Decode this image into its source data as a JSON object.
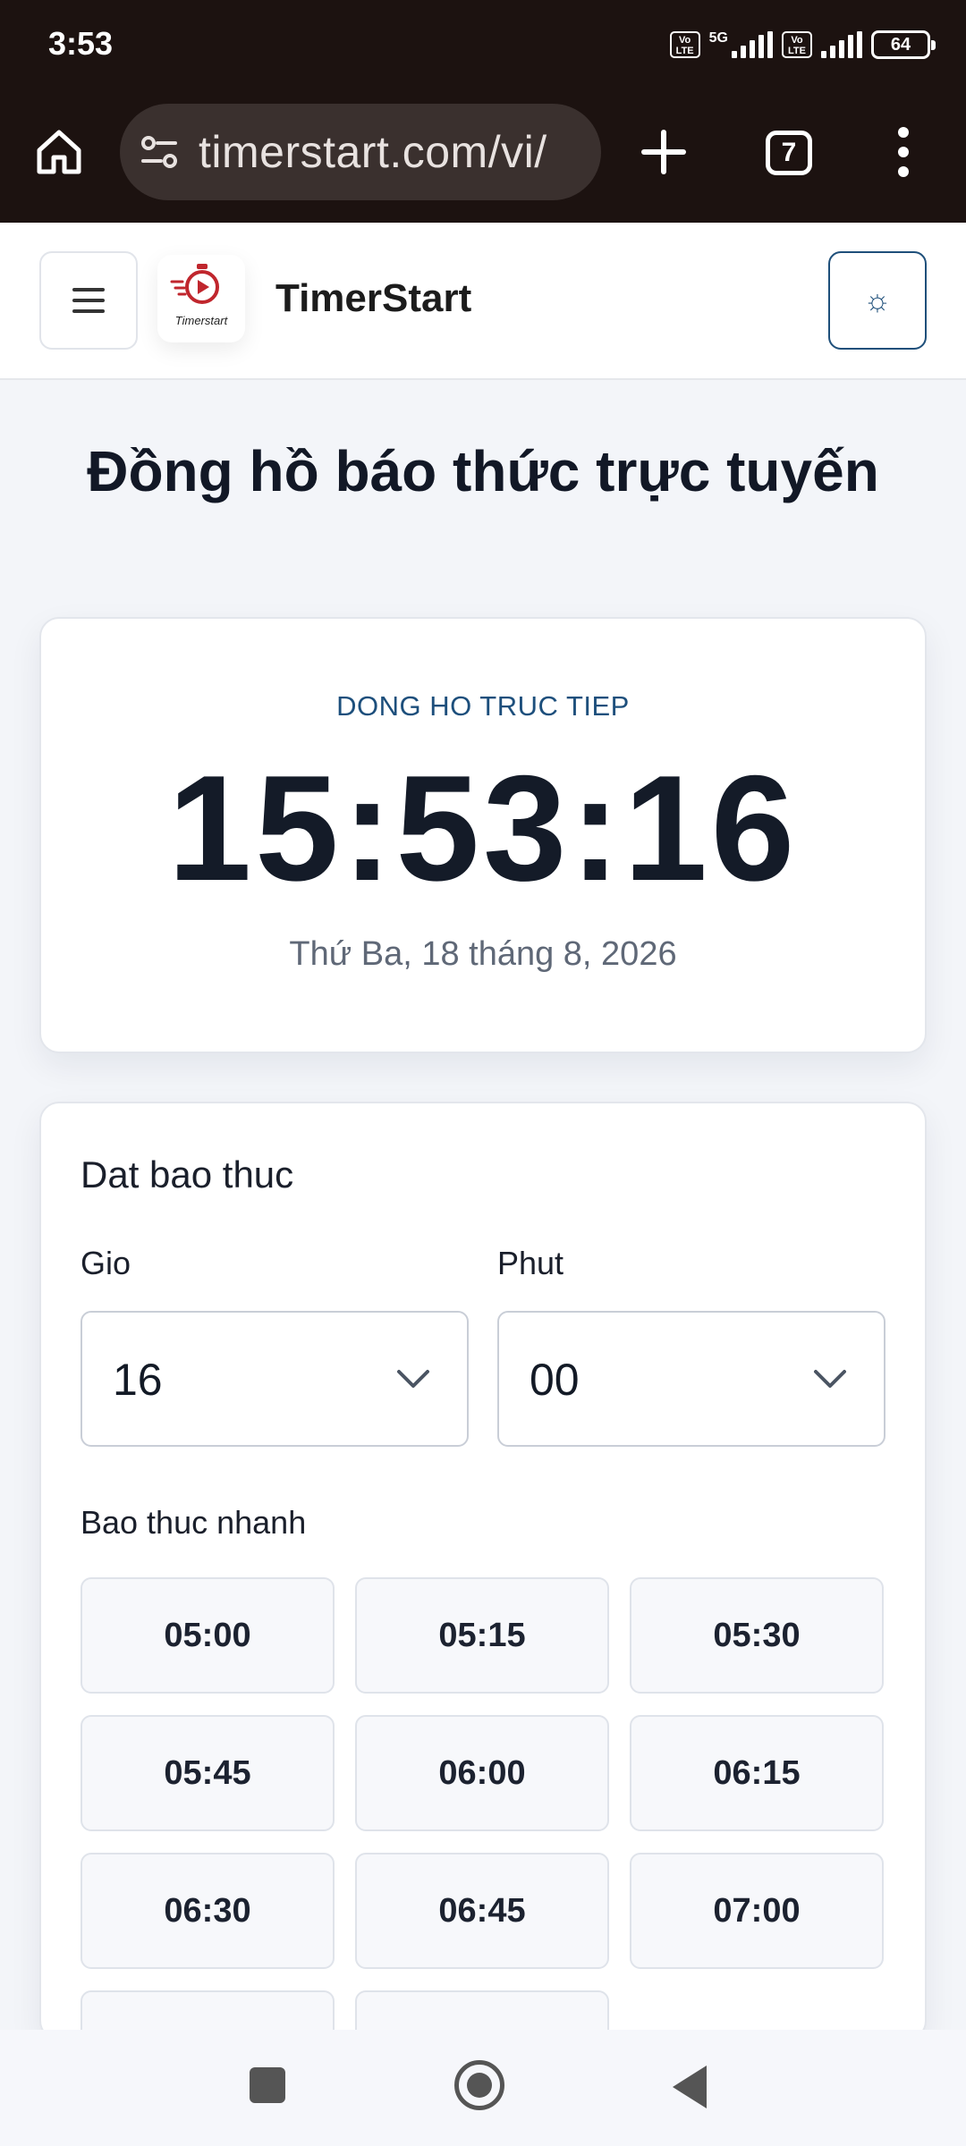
{
  "status_bar": {
    "time": "3:53",
    "network": "5G",
    "volte_label": "Vo\nLTE",
    "battery": "64"
  },
  "browser": {
    "url": "timerstart.com/vi/",
    "tab_count": "7"
  },
  "header": {
    "brand_name": "TimerStart",
    "logo_text": "Timerstart",
    "theme_icon": "☼"
  },
  "page": {
    "title": "Đồng hồ báo thức trực tuyến"
  },
  "clock": {
    "label": "DONG HO TRUC TIEP",
    "time": "15:53:16",
    "date": "Thứ Ba, 18 tháng 8, 2026"
  },
  "alarm": {
    "title": "Dat bao thuc",
    "hour_label": "Gio",
    "hour_value": "16",
    "minute_label": "Phut",
    "minute_value": "00",
    "quick_label": "Bao thuc nhanh",
    "quick_times": [
      "05:00",
      "05:15",
      "05:30",
      "05:45",
      "06:00",
      "06:15",
      "06:30",
      "06:45",
      "07:00",
      "",
      ""
    ]
  },
  "colors": {
    "brand_red": "#c0262d",
    "accent_blue": "#1e4f7a",
    "browser_bar": "#1c1210"
  }
}
